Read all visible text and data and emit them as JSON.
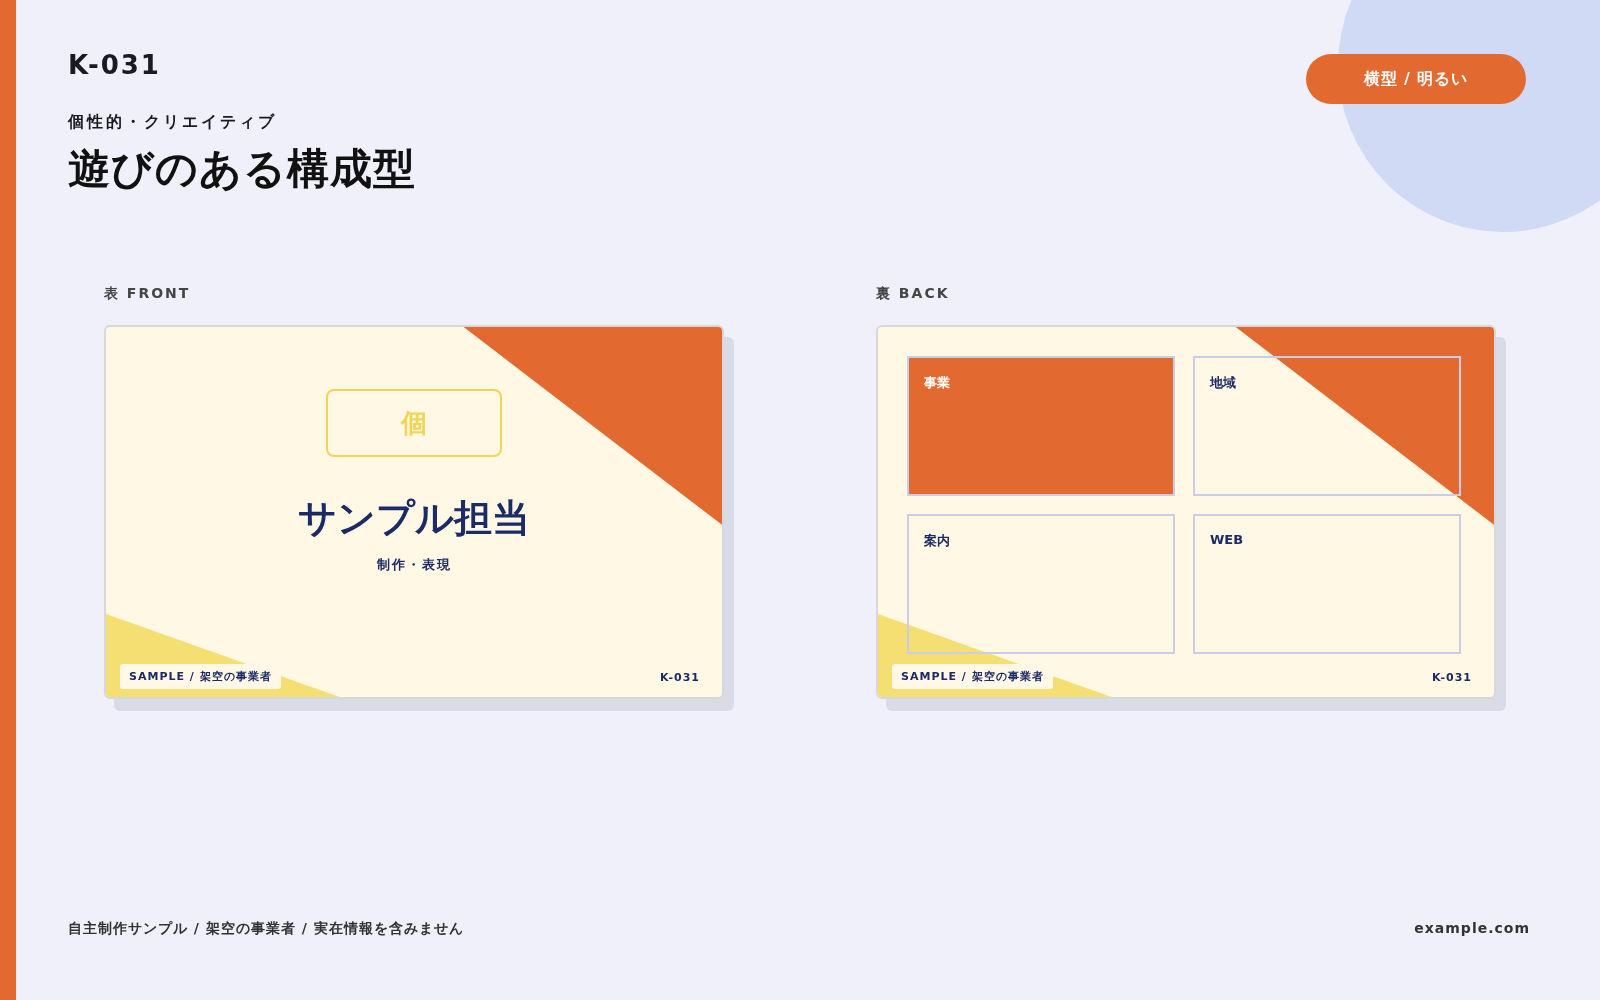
{
  "code": "K-031",
  "category": "個性的・クリエイティブ",
  "title": "遊びのある構成型",
  "badge": "横型 / 明るい",
  "front": {
    "label": "表 FRONT",
    "mark": "個",
    "name": "サンプル担当",
    "role": "制作・表現",
    "footer_left": "SAMPLE / 架空の事業者",
    "footer_right": "K-031"
  },
  "back": {
    "label": "裏 BACK",
    "cells": [
      {
        "label": "事業",
        "highlighted": true
      },
      {
        "label": "地域",
        "highlighted": false
      },
      {
        "label": "案内",
        "highlighted": false
      },
      {
        "label": "WEB",
        "highlighted": false
      }
    ],
    "footer_left": "SAMPLE / 架空の事業者",
    "footer_right": "K-031"
  },
  "footer": {
    "note": "自主制作サンプル / 架空の事業者 / 実在情報を含みません",
    "site": "example.com"
  }
}
